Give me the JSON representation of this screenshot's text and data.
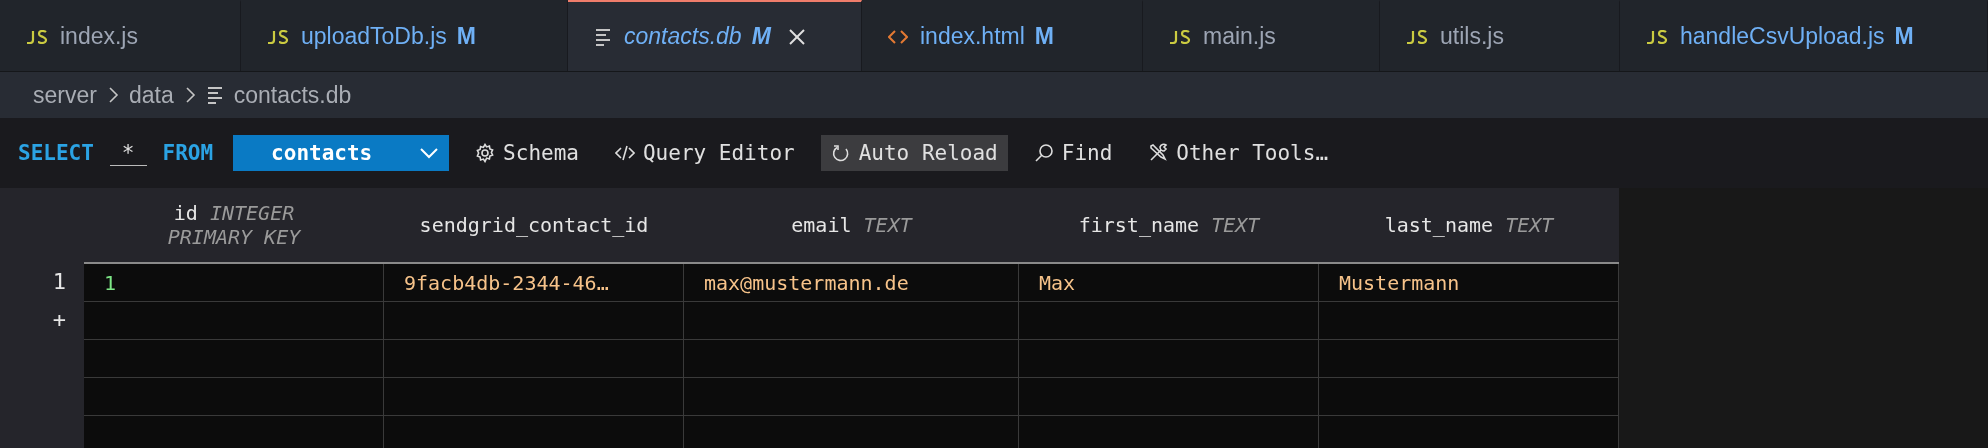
{
  "tabs": [
    {
      "label": "index.js",
      "kind": "js",
      "modified": false,
      "selected": false,
      "preview": false
    },
    {
      "label": "uploadToDb.js",
      "kind": "js",
      "status": "M",
      "modified": true,
      "selected": false,
      "preview": false
    },
    {
      "label": "contacts.db",
      "kind": "db",
      "status": "M",
      "modified": true,
      "selected": true,
      "preview": true
    },
    {
      "label": "index.html",
      "kind": "html",
      "status": "M",
      "modified": true,
      "selected": false,
      "preview": false
    },
    {
      "label": "main.js",
      "kind": "js",
      "modified": false,
      "selected": false,
      "preview": false
    },
    {
      "label": "utils.js",
      "kind": "js",
      "modified": false,
      "selected": false,
      "preview": false
    },
    {
      "label": "handleCsvUpload.js",
      "kind": "js",
      "status": "M",
      "modified": true,
      "selected": false,
      "preview": false
    }
  ],
  "breadcrumb": [
    {
      "label": "server",
      "kind": "folder"
    },
    {
      "label": "data",
      "kind": "folder"
    },
    {
      "label": "contacts.db",
      "kind": "file"
    }
  ],
  "toolbar": {
    "select_keyword": "SELECT",
    "star": "*",
    "from_keyword": "FROM",
    "table": "contacts",
    "buttons": [
      {
        "label": "Schema",
        "kind": "schema",
        "on": false
      },
      {
        "label": "Query Editor",
        "kind": "query",
        "on": false
      },
      {
        "label": "Auto Reload",
        "kind": "reload",
        "on": true
      },
      {
        "label": "Find",
        "kind": "find",
        "on": false
      },
      {
        "label": "Other Tools…",
        "kind": "tools",
        "on": false
      }
    ]
  },
  "table": {
    "columns": [
      {
        "name": "id",
        "type": "INTEGER PRIMARY KEY"
      },
      {
        "name": "sendgrid_contact_id"
      },
      {
        "name": "email",
        "type": "TEXT"
      },
      {
        "name": "first_name",
        "type": "TEXT"
      },
      {
        "name": "last_name",
        "type": "TEXT"
      }
    ],
    "rows": [
      {
        "number": "1",
        "cells": [
          {
            "kind": "integer",
            "value": "1"
          },
          {
            "kind": "text",
            "value": "9facb4db-2344-46…"
          },
          {
            "kind": "text",
            "value": "max@mustermann.de"
          },
          {
            "kind": "text",
            "value": "Max"
          },
          {
            "kind": "text",
            "value": "Mustermann"
          }
        ]
      }
    ],
    "add_row": "+"
  }
}
